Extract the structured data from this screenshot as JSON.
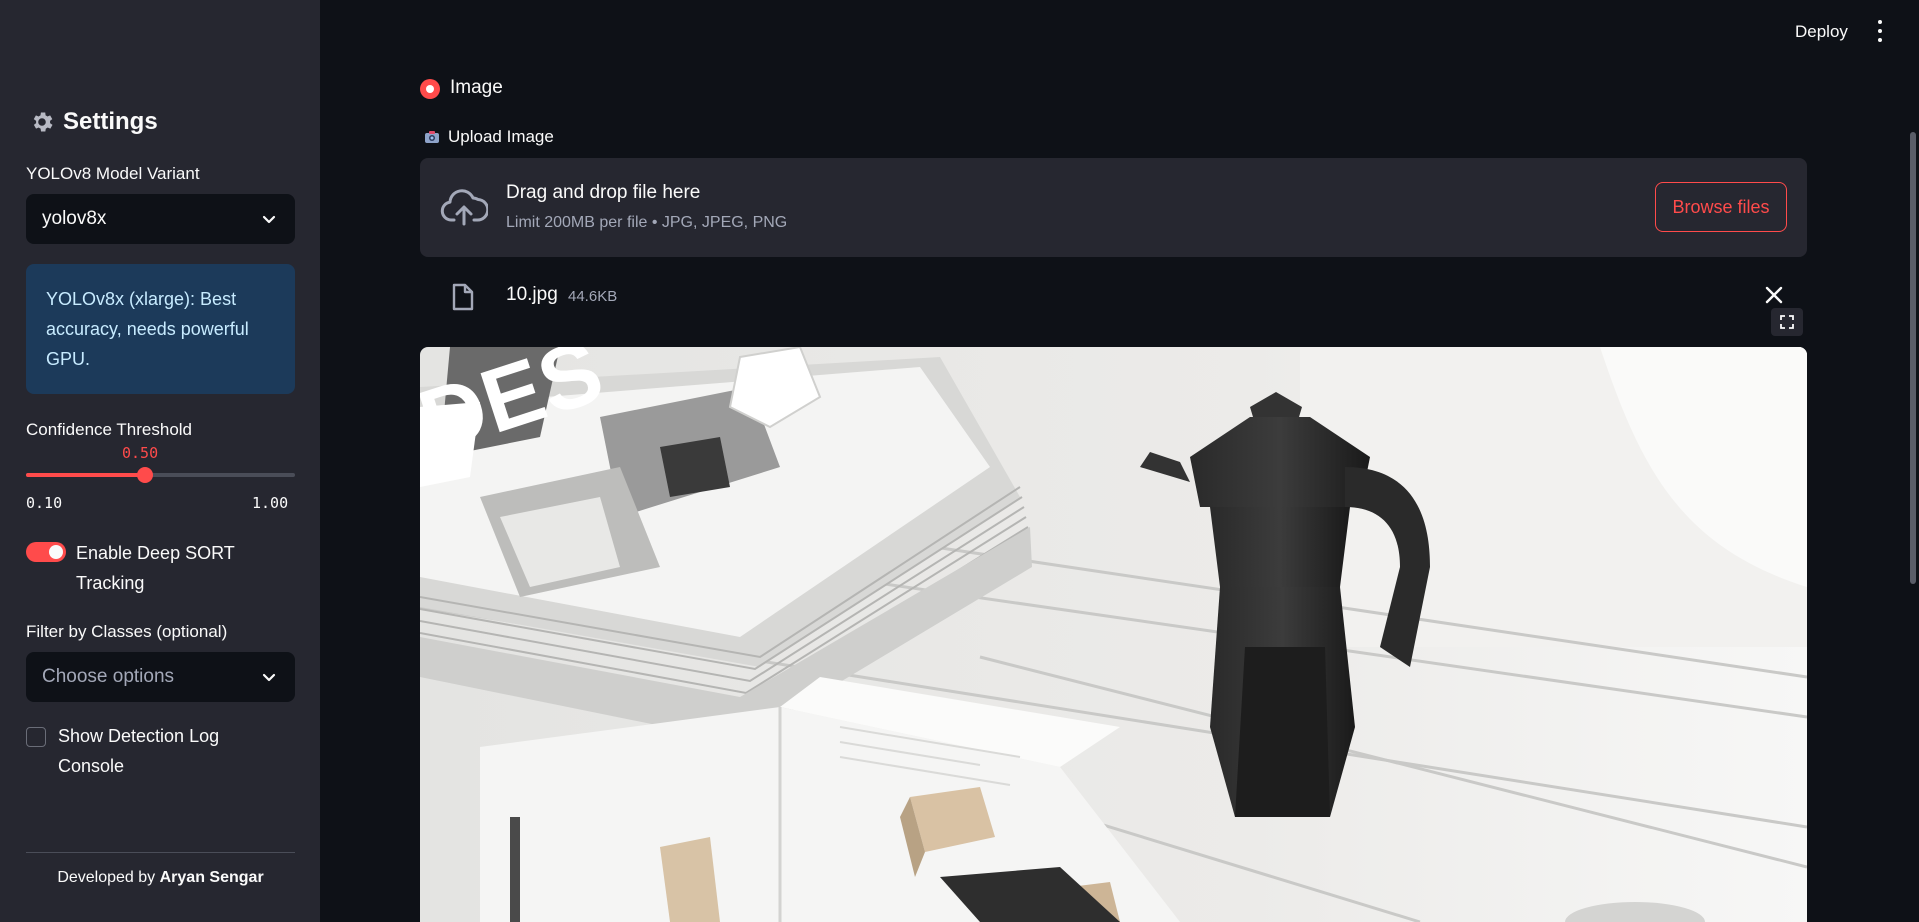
{
  "sidebar": {
    "title": "Settings",
    "model_label": "YOLOv8 Model Variant",
    "model_value": "yolov8x",
    "info_text": "YOLOv8x (xlarge): Best accuracy, needs powerful GPU.",
    "confidence_label": "Confidence Threshold",
    "confidence_value": "0.50",
    "confidence_fraction": 0.444,
    "confidence_min": "0.10",
    "confidence_max": "1.00",
    "tracking_label": "Enable Deep SORT Tracking",
    "tracking_enabled": true,
    "filter_label": "Filter by Classes (optional)",
    "filter_placeholder": "Choose options",
    "log_label": "Show Detection Log Console",
    "log_checked": false,
    "footer_prefix": "Developed by ",
    "footer_author": "Aryan Sengar"
  },
  "header": {
    "deploy_label": "Deploy"
  },
  "main": {
    "mode_label": "Image",
    "upload_label": "Upload Image",
    "dropzone_title": "Drag and drop file here",
    "dropzone_subtitle": "Limit 200MB per file • JPG, JPEG, PNG",
    "browse_label": "Browse files",
    "file_name": "10.jpg",
    "file_size": "44.6KB"
  },
  "colors": {
    "accent": "#ff4b4b",
    "sidebar_bg": "#262730",
    "app_bg": "#0e1117",
    "info_bg": "#1c3a5a"
  },
  "icons": {
    "settings": "gear-icon",
    "upload": "cloud-upload-icon",
    "file": "file-icon",
    "remove": "close-icon",
    "menu": "kebab-menu-icon",
    "fullscreen": "fullscreen-icon",
    "camera": "camera-icon"
  }
}
